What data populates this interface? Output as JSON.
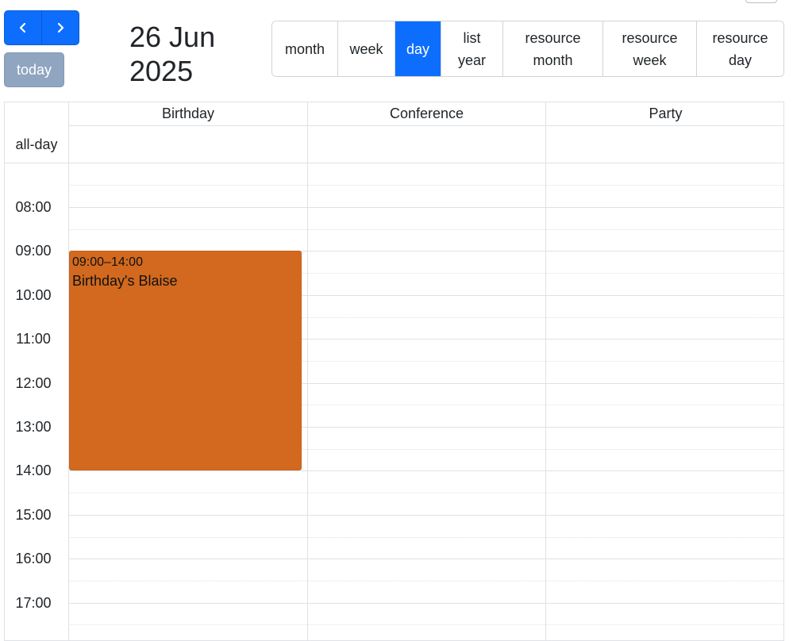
{
  "toolbar": {
    "prev_icon": "chevron-left-icon",
    "next_icon": "chevron-right-icon",
    "today_label": "today",
    "title": "26 Jun 2025",
    "views": [
      {
        "label": "month",
        "active": false
      },
      {
        "label": "week",
        "active": false
      },
      {
        "label": "day",
        "active": true
      },
      {
        "label": "list\nyear",
        "active": false
      },
      {
        "label": "resource\nmonth",
        "active": false
      },
      {
        "label": "resource\nweek",
        "active": false
      },
      {
        "label": "resource\nday",
        "active": false
      }
    ]
  },
  "calendar": {
    "resources": [
      "Birthday",
      "Conference",
      "Party"
    ],
    "all_day_label": "all-day",
    "time_labels": [
      "08:00",
      "09:00",
      "10:00",
      "11:00",
      "12:00",
      "13:00",
      "14:00",
      "15:00",
      "16:00",
      "17:00"
    ],
    "events": [
      {
        "resource": "Birthday",
        "time": "09:00–14:00",
        "title": "Birthday's Blaise",
        "color": "#d2691e"
      }
    ]
  },
  "colors": {
    "primary": "#0d6efd",
    "today_button": "#8fa5c0",
    "event": "#d2691e",
    "grid_line": "#dee2e6"
  }
}
